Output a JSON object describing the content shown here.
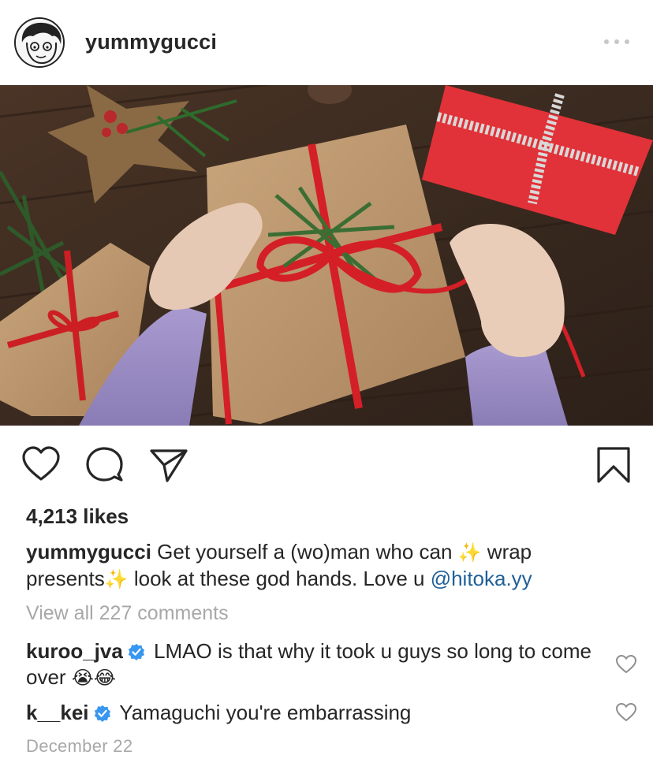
{
  "post": {
    "username": "yummygucci",
    "likes": "4,213 likes",
    "caption": {
      "username": "yummygucci",
      "text_1": " Get yourself a (wo)man who can ",
      "emoji_1": "✨",
      "text_2": " wrap presents",
      "emoji_2": "✨",
      "text_3": "  look at these god hands. Love u ",
      "mention": "@hitoka.yy"
    },
    "view_all": "View all 227 comments",
    "comments": [
      {
        "username": "kuroo_jva",
        "verified": true,
        "text": " LMAO is that why it took u guys so long to come over ",
        "emojis": "😭😂"
      },
      {
        "username": "k__kei",
        "verified": true,
        "text": " Yamaguchi you're embarrassing",
        "emojis": ""
      }
    ],
    "date": "December 22"
  },
  "icons": {
    "avatar": "avatar-drawing",
    "more": "more-dots-icon",
    "like": "heart-icon",
    "comment": "comment-icon",
    "share": "share-paper-plane-icon",
    "save": "bookmark-icon",
    "comment_like": "small-heart-icon",
    "verified": "verified-badge-icon"
  },
  "colors": {
    "text": "#262626",
    "muted": "#a8a8a8",
    "mention": "#1f5f99",
    "verified": "#3897f0"
  }
}
